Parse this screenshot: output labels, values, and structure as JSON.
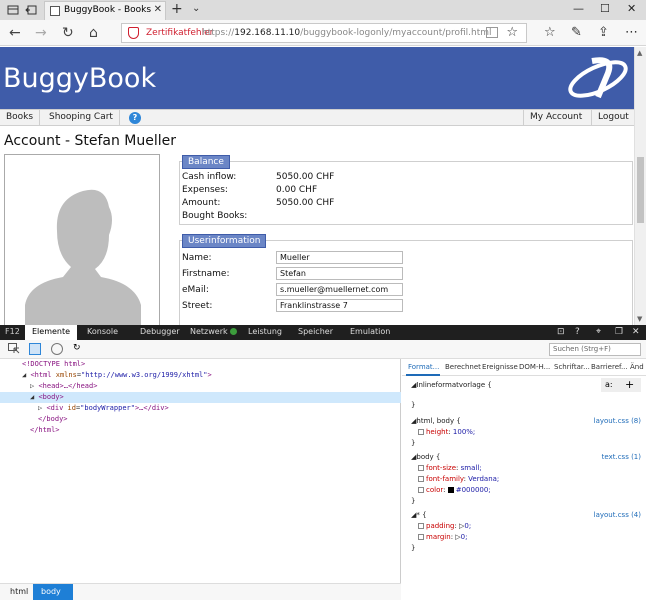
{
  "browser": {
    "tab_title": "BuggyBook - Books are",
    "address": {
      "cert_warning": "Zertifikatfehler",
      "url_prefix": "https://",
      "url_host": "192.168.11.10",
      "url_path": "/buggybook-logonly/myaccount/profil.html"
    }
  },
  "site": {
    "brand": "BuggyBook",
    "menu": {
      "books": "Books",
      "cart": "Shooping Cart",
      "help": "?",
      "account": "My Account",
      "logout": "Logout"
    },
    "page_title": "Account - Stefan Mueller",
    "balance": {
      "legend": "Balance",
      "rows": [
        {
          "label": "Cash inflow:",
          "value": "5050.00 CHF"
        },
        {
          "label": "Expenses:",
          "value": "0.00 CHF"
        },
        {
          "label": "Amount:",
          "value": "5050.00 CHF"
        },
        {
          "label": "Bought Books:",
          "value": ""
        }
      ]
    },
    "userinfo": {
      "legend": "Userinformation",
      "rows": [
        {
          "label": "Name:",
          "value": "Mueller"
        },
        {
          "label": "Firstname:",
          "value": "Stefan"
        },
        {
          "label": "eMail:",
          "value": "s.mueller@muellernet.com"
        },
        {
          "label": "Street:",
          "value": "Franklinstrasse 7"
        }
      ]
    }
  },
  "devtools": {
    "f12": "F12",
    "tabs": [
      "Elemente",
      "Konsole",
      "Debugger",
      "Netzwerk",
      "Leistung",
      "Speicher",
      "Emulation"
    ],
    "active_tab": "Elemente",
    "search_placeholder": "Suchen (Strg+F)",
    "dom": {
      "doctype": "<!DOCTYPE html>",
      "html_open": "<html",
      "html_attr": "xmlns",
      "html_val": "\"http://www.w3.org/1999/xhtml\"",
      "head": "<head>…</head>",
      "body_open": "<body>",
      "div_open": "<div",
      "div_attr": "id",
      "div_val": "\"bodyWrapper\"",
      "div_close": ">…</div>",
      "body_close": "</body>",
      "html_close": "</html>"
    },
    "style_tabs": [
      "Format...",
      "Berechnet",
      "Ereignisse",
      "DOM-H...",
      "Schriftar...",
      "Barrieref...",
      "Änd"
    ],
    "styles": {
      "inline": "Inlineformatvorlage",
      "rule1_selector": "html, body",
      "rule1_source": "layout.css (8)",
      "rule1_prop": "height",
      "rule1_val": "100%;",
      "rule2_selector": "body",
      "rule2_source": "text.css (1)",
      "rule2_props": [
        {
          "name": "font-size",
          "value": "small;"
        },
        {
          "name": "font-family",
          "value": "Verdana;"
        },
        {
          "name": "color",
          "value": "#000000;"
        }
      ],
      "rule3_selector": "*",
      "rule3_source": "layout.css (4)",
      "rule3_props": [
        {
          "name": "padding",
          "value": "0;"
        },
        {
          "name": "margin",
          "value": "0;"
        }
      ]
    },
    "breadcrumb": [
      "html",
      "body"
    ]
  }
}
